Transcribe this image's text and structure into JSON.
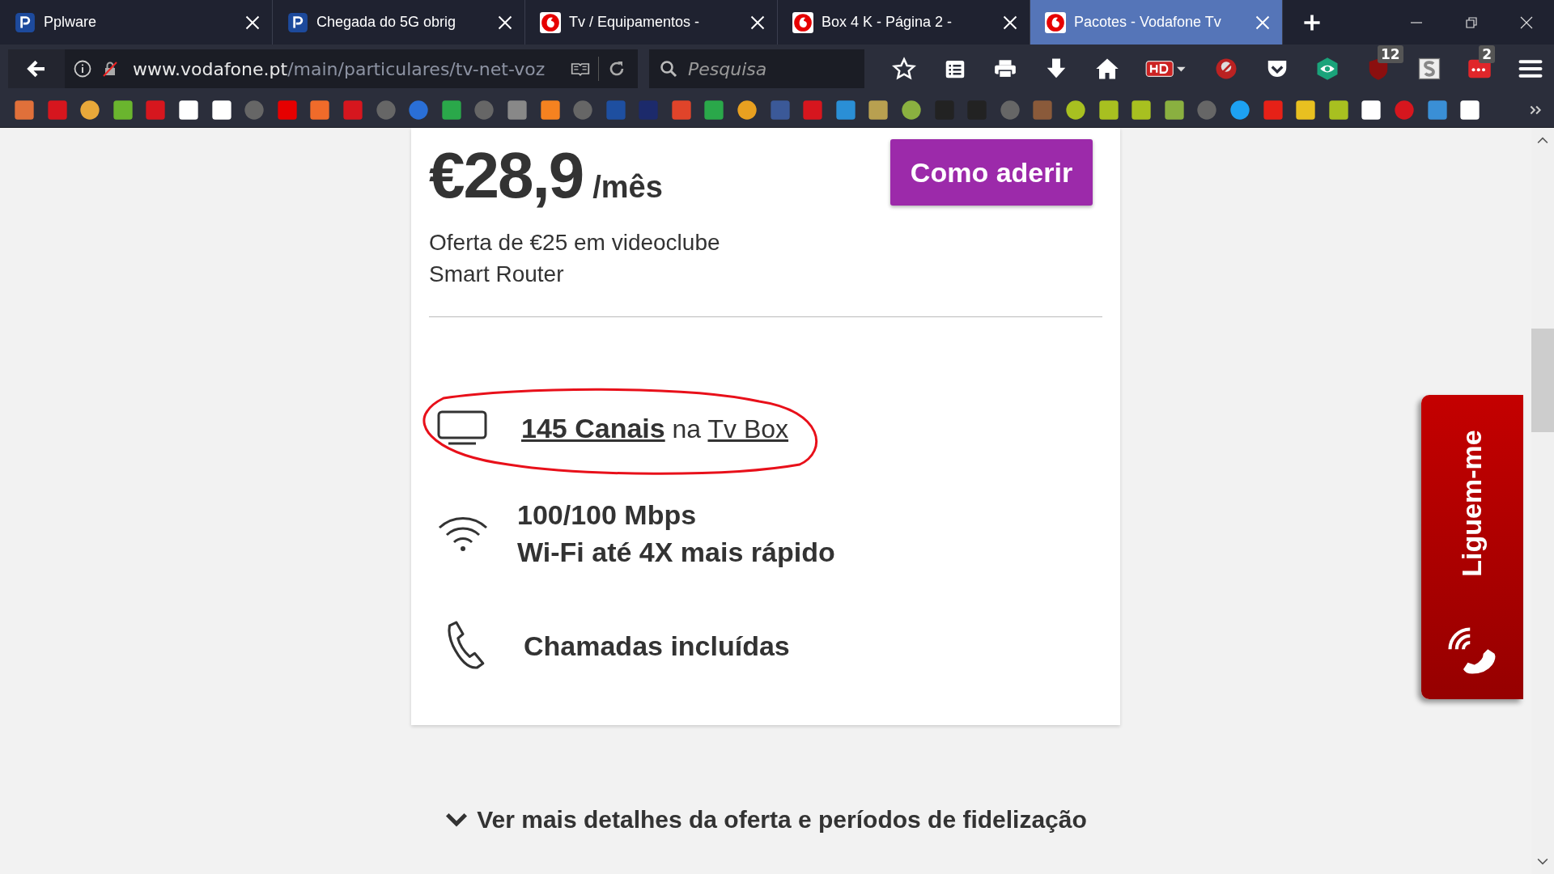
{
  "tabs": [
    {
      "title": "Pplware",
      "kind": "letter",
      "selected": false
    },
    {
      "title": "Chegada do 5G obrig",
      "kind": "letter",
      "selected": false
    },
    {
      "title": "Tv / Equipamentos -",
      "kind": "drop",
      "selected": false
    },
    {
      "title": "Box 4 K - Página 2 -",
      "kind": "drop",
      "selected": false
    },
    {
      "title": "Pacotes - Vodafone Tv",
      "kind": "drop",
      "selected": true
    }
  ],
  "address_bar": {
    "domain": "www.vodafone.pt",
    "path": "/main/particulares/tv-net-voz"
  },
  "search": {
    "placeholder": "Pesquisa"
  },
  "extension_badges": [
    "12",
    "2"
  ],
  "offer": {
    "price": "€28,9",
    "period": "/mês",
    "cta": "Como aderir",
    "extras": [
      "Oferta de €25 em videoclube",
      "Smart Router"
    ],
    "features": [
      {
        "kind": "tv",
        "parts": [
          {
            "kind": "strong-link",
            "text": "145 Canais"
          },
          {
            "kind": "plain",
            "text": "na"
          },
          {
            "kind": "link",
            "text": "Tv Box"
          }
        ]
      },
      {
        "kind": "wifi",
        "lines": [
          "100/100 Mbps",
          "Wi-Fi até 4X mais rápido"
        ]
      },
      {
        "kind": "phone",
        "lines": [
          "Chamadas incluídas"
        ]
      }
    ]
  },
  "details_link": "Ver mais detalhes da oferta e períodos de fidelização",
  "callback_tab": "Liguem-me"
}
